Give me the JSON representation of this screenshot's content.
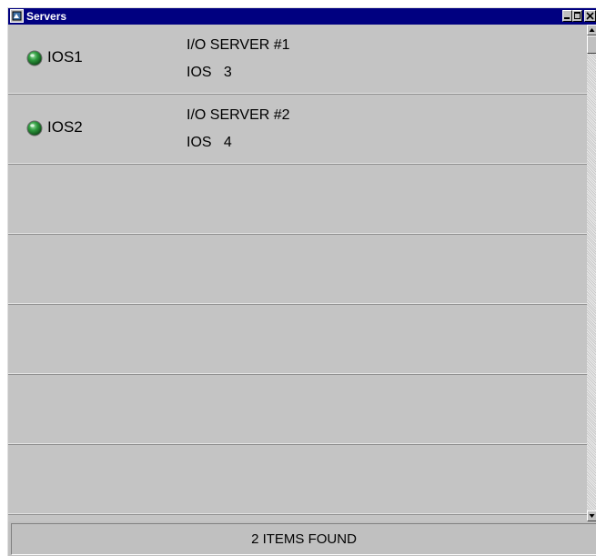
{
  "window": {
    "title": "Servers",
    "title_icon": "app-window-icon",
    "controls": [
      "minimize-icon",
      "maximize-icon",
      "close-icon"
    ]
  },
  "servers": [
    {
      "name": "IOS1",
      "description": "I/O SERVER #1",
      "type": "IOS",
      "number": "3",
      "status_color": "#1f7a2e"
    },
    {
      "name": "IOS2",
      "description": "I/O SERVER #2",
      "type": "IOS",
      "number": "4",
      "status_color": "#1f7a2e"
    }
  ],
  "empty_rows": 5,
  "status": {
    "text": "2 ITEMS FOUND"
  },
  "colors": {
    "title_bar": "#000080",
    "list_background": "#c4c4c4",
    "status_led": "#1f7a2e"
  }
}
